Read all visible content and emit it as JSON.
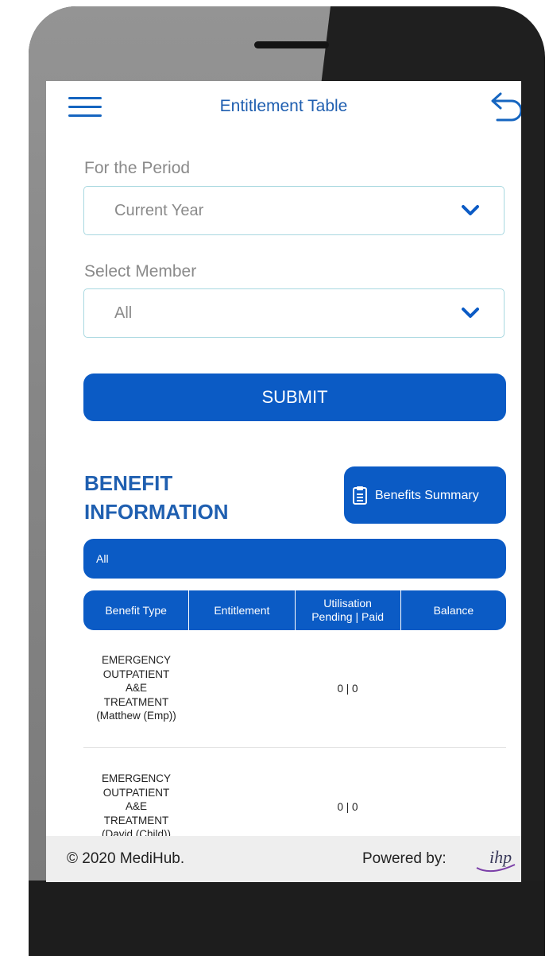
{
  "header": {
    "title": "Entitlement Table",
    "menu_icon": "hamburger-menu-icon",
    "back_icon": "undo-arrow-icon"
  },
  "filters": {
    "period_label": "For the Period",
    "period_value": "Current Year",
    "member_label": "Select Member",
    "member_value": "All"
  },
  "submit_label": "SUBMIT",
  "benefit": {
    "title_line1": "BENEFIT",
    "title_line2": "INFORMATION",
    "summary_button": "Benefits Summary",
    "filter_value": "All"
  },
  "table": {
    "headers": [
      "Benefit Type",
      "Entitlement",
      "Utilisation Pending | Paid",
      "Balance"
    ],
    "rows": [
      {
        "type_lines": [
          "EMERGENCY",
          "OUTPATIENT",
          "A&E",
          "TREATMENT",
          "(Matthew (Emp))"
        ],
        "utilisation": "0 | 0"
      },
      {
        "type_lines": [
          "EMERGENCY",
          "OUTPATIENT",
          "A&E",
          "TREATMENT",
          "(David (Child))"
        ],
        "utilisation": "0 | 0"
      }
    ]
  },
  "footer": {
    "copyright": "© 2020 MediHub.",
    "powered_by": "Powered by:",
    "logo_text": "ihp"
  },
  "colors": {
    "primary": "#0b5bc5",
    "title": "#1f5fb0",
    "border": "#a8d8e0"
  }
}
